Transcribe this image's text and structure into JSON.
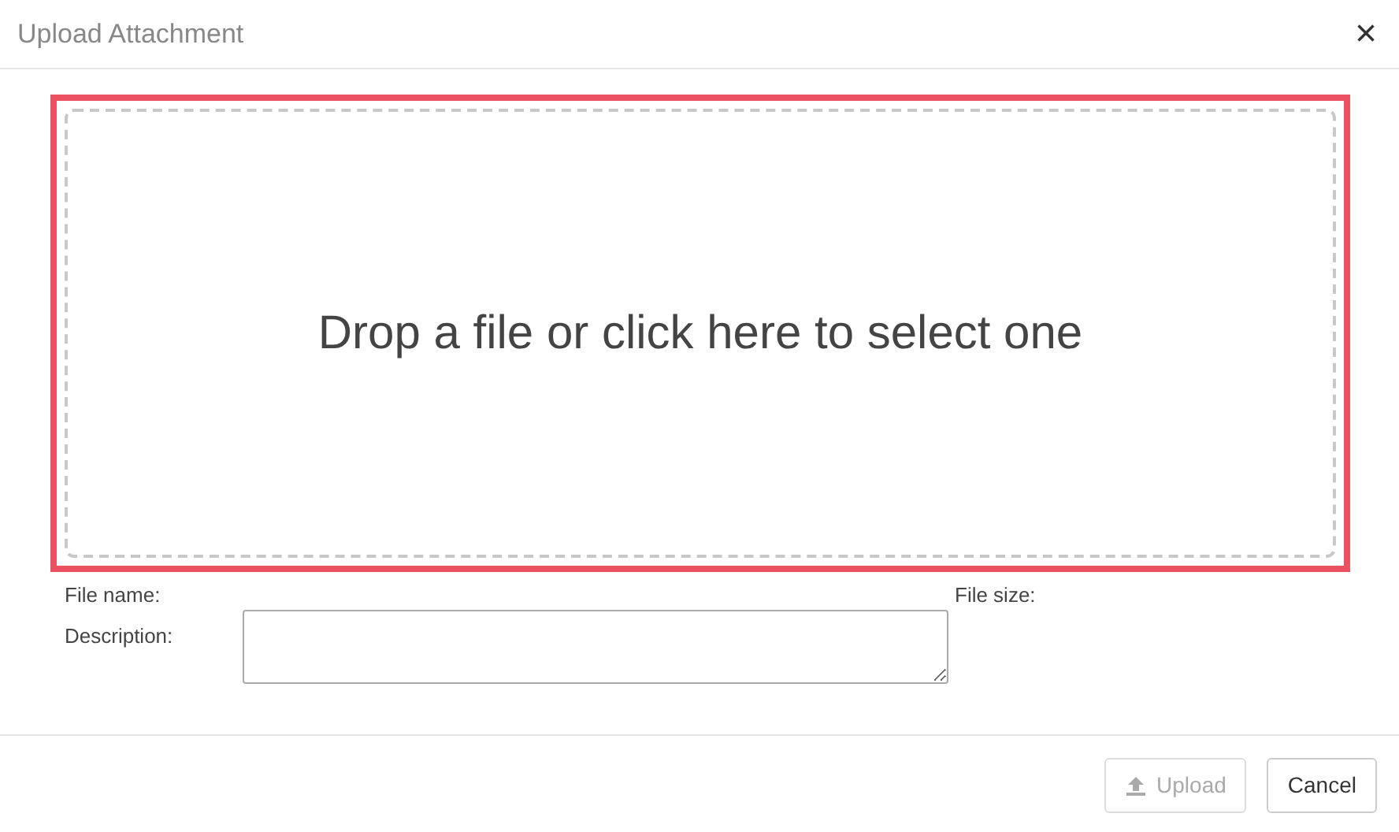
{
  "dialog": {
    "title": "Upload Attachment",
    "close": "×"
  },
  "dropzone": {
    "text": "Drop a file or click here to select one",
    "highlighted": true
  },
  "fields": {
    "file_name_label": "File name:",
    "file_size_label": "File size:",
    "description_label": "Description:"
  },
  "buttons": [
    {
      "label": "Upload",
      "kind": "upload",
      "disabled": true
    },
    {
      "label": "Cancel",
      "kind": "cancel",
      "disabled": false
    }
  ]
}
